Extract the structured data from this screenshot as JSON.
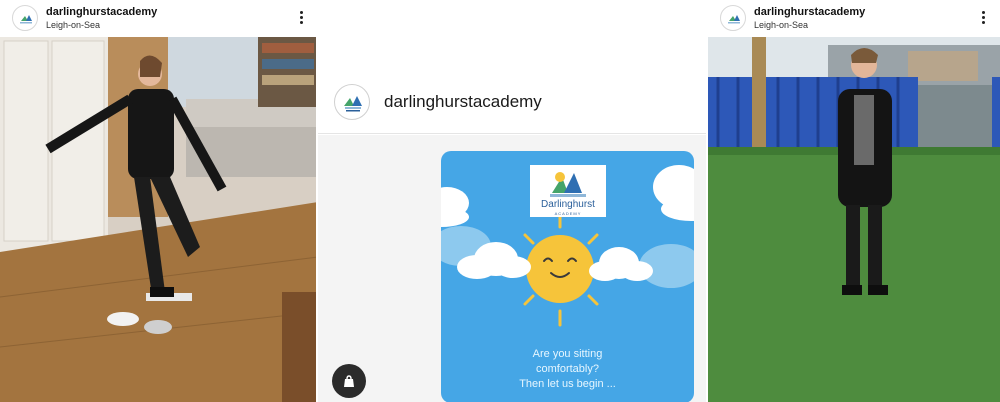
{
  "posts": {
    "left": {
      "username": "darlinghurstacademy",
      "location": "Leigh-on-Sea",
      "avatar_icon": "school-logo-icon",
      "menu_icon": "more-vertical-icon"
    },
    "center": {
      "username": "darlinghurstacademy",
      "avatar_icon": "school-logo-icon",
      "logo_text": "Darlinghurst",
      "logo_subtext": "ACADEMY",
      "caption_lines": [
        "Are you sitting",
        "comfortably?",
        "Then let us begin ..."
      ],
      "badge_icon": "bag-icon"
    },
    "right": {
      "username": "darlinghurstacademy",
      "location": "Leigh-on-Sea",
      "avatar_icon": "school-logo-icon",
      "menu_icon": "more-vertical-icon"
    }
  },
  "colors": {
    "card_blue": "#45a6e6",
    "sun": "#f6c43a",
    "cloud": "#ffffff",
    "badge": "#2b2b2b"
  }
}
